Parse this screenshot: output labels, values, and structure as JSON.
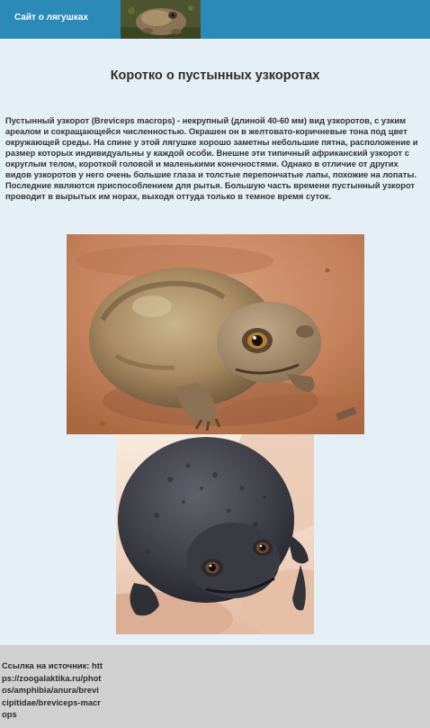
{
  "header": {
    "site_link": "Сайт о лягушках"
  },
  "article": {
    "title": "Коротко о пустынных узкоротах",
    "body": "Пустынный узкорот (Breviceps macrops) - некрупный (длиной 40-60 мм) вид узкоротов, с узким ареалом и сокращающейся численностью. Окрашен он в желтовато-коричневые тона под цвет окружающей среды. На спине у этой лягушке хорошо заметны небольшие пятна, расположение и размер которых индивидуальны у каждой особи. Внешне эти типичный африканский узкорот с округлым телом, короткой головой и маленькими конечностями. Однако в отличие от других видов узкоротов у него очень большие глаза и толстые перепончатые лапы, похожие на лопаты. Последние являются приспособлением для рытья. Большую часть времени пустынный узкорот проводит в вырытых им норах, выходя оттуда только в темное время суток."
  },
  "footer": {
    "source_text": "Ссылка на источник: https://zoogalaktika.ru/photos/amphibia/anura/brevicipitidae/breviceps-macrops"
  },
  "colors": {
    "topbar": "#2b8ab8",
    "page_background": "#e4eff6",
    "footer_background": "#d0d0d0"
  }
}
